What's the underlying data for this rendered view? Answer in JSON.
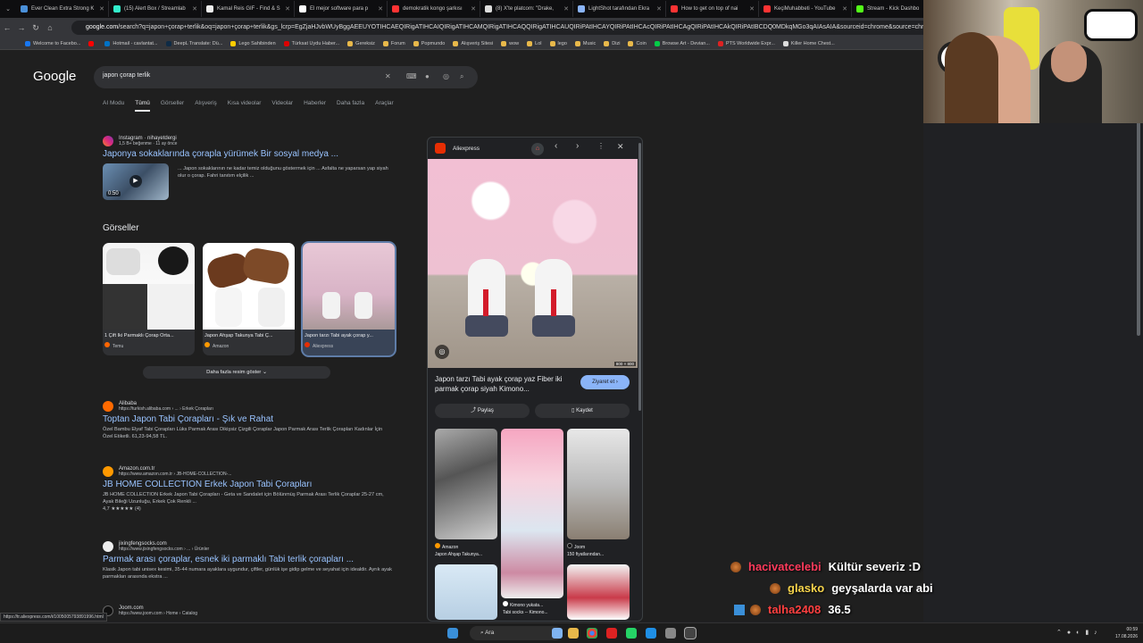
{
  "browser": {
    "tabs": [
      {
        "label": "Ever Clean Extra Strong K",
        "color": "#4a90d9"
      },
      {
        "label": "(15) Alert Box / Streamlab",
        "color": "#3ec"
      },
      {
        "label": "Kamal Reis GIF - Find & S",
        "color": "#eee"
      },
      {
        "label": "El mejor software para p",
        "color": "#fff"
      },
      {
        "label": "demokratik kongo şarkısı",
        "color": "#f33"
      },
      {
        "label": "(8) X'te platcom: \"Drake,",
        "color": "#ddd"
      },
      {
        "label": "LightShot tarafından Ekra",
        "color": "#8ab4f8"
      },
      {
        "label": "How to get on top of nai",
        "color": "#f33"
      },
      {
        "label": "KeçiMuhabbeti - YouTube",
        "color": "#f33"
      },
      {
        "label": "Stream - Kick Dashbo",
        "color": "#53fc18"
      }
    ],
    "url_host": "google.com",
    "url_rest": "/search?q=japon+çorap+terlik&oq=japon+çorap+terlik&gs_lcrp=EgZjaHJvbWUyBggAEEUYOTIHCAEQIRigATIHCAIQIRigATIHCAMQIRigATIHCAQQIRigATIHCAUQIRiPAtIHCAYQIRiPAtIHCAcQIRiPAtIHCAgQIRiPAtIHCAkQIRiPAtIBCDQ0MDkqMGo3qAIAsAIA&sourceid=chrome&source=chrome.ob&ie=UTF-8",
    "bookmarks": [
      "Welcome to Facebo...",
      "",
      "Hotmail - cavlantat...",
      "DeepL Translate: Dü...",
      "Lego Sahibinden",
      "Türksat Uydu Haber...",
      "Gereksiz",
      "Forum",
      "Popmundo",
      "Alışveriş Sitesi",
      "wow",
      "Lol",
      "lego",
      "Music",
      "Dizi",
      "Coin",
      "Browse Art - Devian...",
      "PTS Worldwide Expr...",
      "Killer Home Chest..."
    ]
  },
  "google": {
    "logo": "Google",
    "query": "japon çorap terlik",
    "tabs": [
      "AI Modu",
      "Tümü",
      "Görseller",
      "Alışveriş",
      "Kısa videolar",
      "Videolar",
      "Haberler",
      "Daha fazla",
      "Araçlar"
    ],
    "instagram": {
      "source": "Instagram · nihayetdergi",
      "meta": "1,5 B+ beğenme · 11 ay önce",
      "title": "Japonya sokaklarında çorapla yürümek Bir sosyal medya ...",
      "snippet": "... Japon sokaklarının ne kadar temiz olduğunu göstermek için ... Asfalta ne yaparsan yap siyah olur o çorap. Fahri tanıtım elçilik ...",
      "duration": "0:50"
    },
    "images_heading": "Görseller",
    "images": [
      {
        "caption": "1 Çift İki Parmaklı Çorap Orta...",
        "source": "Temu"
      },
      {
        "caption": "Japon Ahşap Takunya Tabi Ç...",
        "source": "Amazon"
      },
      {
        "caption": "Japon tarzı Tabi ayak çorap y...",
        "source": "Aliexpress"
      }
    ],
    "more_images": "Daha fazla resim göster",
    "results": [
      {
        "site": "Alibaba",
        "url": "https://turkish.alibaba.com › ... › Erkek Çorapları",
        "title": "Toptan Japon Tabi Çorapları - Şık ve Rahat",
        "snippet": "Özel Bambu Elyaf Tabi Çorapları Lüks Parmak Arası Dikişsiz Çizgili Çoraplar Japon Parmak Arası Terlik Çorapları Kadınlar İçin Özel Etiketli. 61,23-94,58 TL."
      },
      {
        "site": "Amazon.com.tr",
        "url": "https://www.amazon.com.tr › JB-HOME-COLLECTION-...",
        "title": "JB HOME COLLECTION Erkek Japon Tabi Çorapları",
        "snippet": "JB HOME COLLECTION Erkek Japon Tabi Çorapları - Geta ve Sandalet için Bölünmüş Parmak Arası Terlik Çoraplar 25-27 cm, Ayak Bileği Uzunluğu, Erkek Çok Renkli ...",
        "rating": "4,7 ★★★★★ (4)"
      },
      {
        "site": "jixingfengsocks.com",
        "url": "https://www.jixingfengsocks.com › ... › Ürünler",
        "title": "Parmak arası çoraplar, esnek iki parmaklı Tabi terlik çorapları ...",
        "snippet": "Klasik Japon tabi unisex kesimi, 35-44 numara ayaklara uygundur, çiftler, günlük işe gidip gelme ve seyahat için idealdir. Ayrık ayak parmakları arasında ekstra ..."
      },
      {
        "site": "Joom.com",
        "url": "https://www.joom.com › Home › Catalog"
      }
    ],
    "panel": {
      "source": "Aliexpress",
      "dims": "800 × 800",
      "title": "Japon tarzı Tabi ayak çorap yaz Fiber iki parmak çorap siyah Kimono...",
      "visit": "Ziyaret et",
      "share": "Paylaş",
      "save": "Kaydet",
      "thumbs": [
        {
          "source": "Amazon",
          "caption": "Japon Ahşap Takunya..."
        },
        {
          "source": "Kimono yukata...",
          "caption": "Tabi socks -- Kimono..."
        },
        {
          "source": "Joom",
          "caption": "150 fiyatlarından..."
        }
      ]
    },
    "status_url": "https://tr.aliexpress.com/i/1005005793891996.html"
  },
  "chat": [
    {
      "user": "hacivatcelebi",
      "color": "#ff3b5c",
      "message": "Kültür severiz :D"
    },
    {
      "user": "glasko",
      "color": "#f5d34b",
      "message": "geyşalarda var abi"
    },
    {
      "user": "talha2408",
      "color": "#ff4040",
      "message": "36.5"
    }
  ],
  "taskbar": {
    "search": "Ara",
    "time": "00:59",
    "date": "17.08.2026"
  }
}
